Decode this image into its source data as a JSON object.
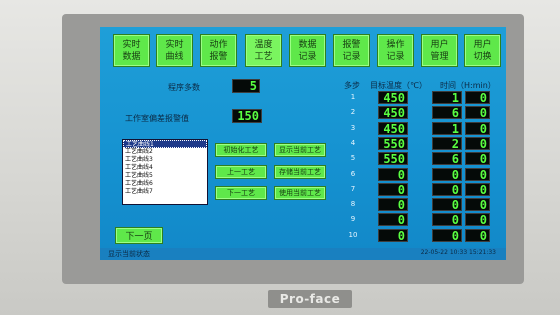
{
  "nav_tabs": [
    {
      "label": "实时\n数据"
    },
    {
      "label": "实时\n曲线"
    },
    {
      "label": "动作\n报警"
    },
    {
      "label": "温度\n工艺"
    },
    {
      "label": "数据\n记录"
    },
    {
      "label": "报警\n记录"
    },
    {
      "label": "操作\n记录"
    },
    {
      "label": "用户\n管理"
    },
    {
      "label": "用户\n切换"
    }
  ],
  "program_steps": {
    "label": "程序多数",
    "value": "5"
  },
  "deviation_alarm": {
    "label": "工作室偏差报警值",
    "value": "150"
  },
  "table": {
    "header_step": "多步",
    "header_temp": "目标温度（℃）",
    "header_time": "时间（H:min）",
    "rows": [
      {
        "step": "1",
        "temp": "450",
        "h": "1",
        "m": "0"
      },
      {
        "step": "2",
        "temp": "450",
        "h": "6",
        "m": "0"
      },
      {
        "step": "3",
        "temp": "450",
        "h": "1",
        "m": "0"
      },
      {
        "step": "4",
        "temp": "550",
        "h": "2",
        "m": "0"
      },
      {
        "step": "5",
        "temp": "550",
        "h": "6",
        "m": "0"
      },
      {
        "step": "6",
        "temp": "0",
        "h": "0",
        "m": "0"
      },
      {
        "step": "7",
        "temp": "0",
        "h": "0",
        "m": "0"
      },
      {
        "step": "8",
        "temp": "0",
        "h": "0",
        "m": "0"
      },
      {
        "step": "9",
        "temp": "0",
        "h": "0",
        "m": "0"
      },
      {
        "step": "10",
        "temp": "0",
        "h": "0",
        "m": "0"
      }
    ]
  },
  "process_list": [
    "工艺曲线1",
    "工艺曲线2",
    "工艺曲线3",
    "工艺曲线4",
    "工艺曲线5",
    "工艺曲线6",
    "工艺曲线7"
  ],
  "buttons": {
    "init": "初始化工艺",
    "show_current": "显示当前工艺",
    "prev": "上一工艺",
    "save_current": "存储当前工艺",
    "next": "下一工艺",
    "use_current": "使用当前工艺",
    "next_page": "下一页"
  },
  "status": {
    "left": "显示当前状态",
    "right": "22-05-22 10:33 15:21:33"
  },
  "brand": "Pro-face"
}
